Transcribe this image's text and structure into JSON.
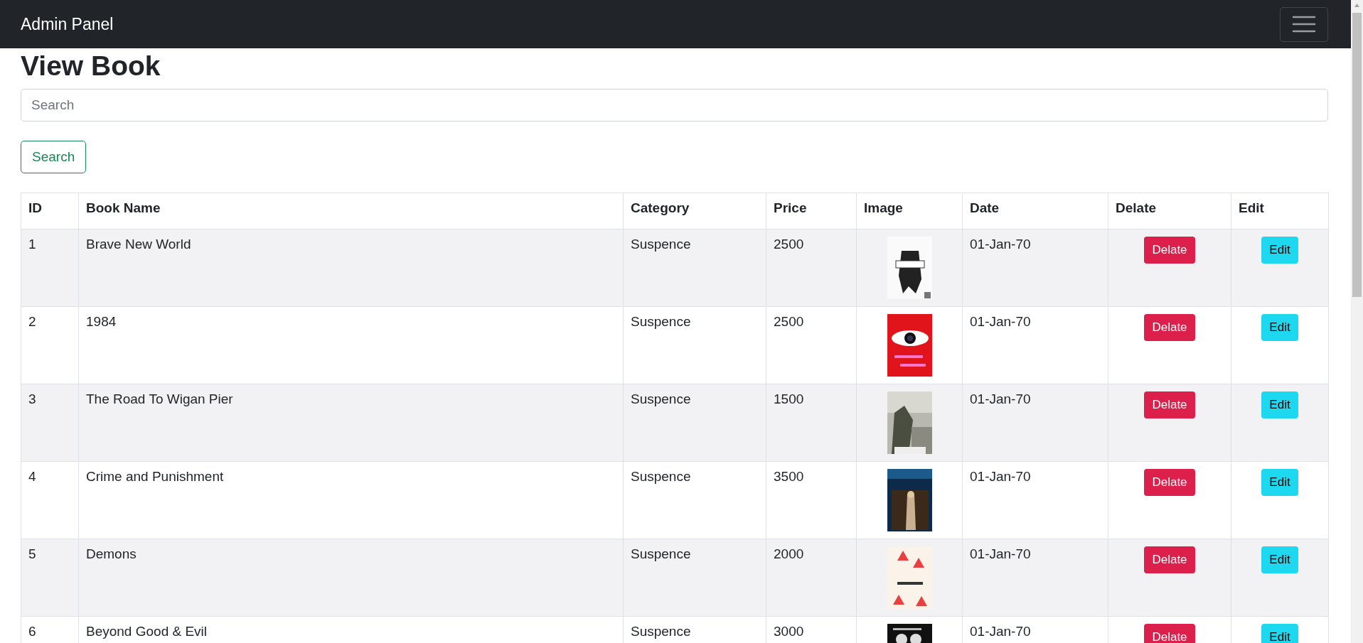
{
  "navbar": {
    "brand": "Admin Panel"
  },
  "page_title": "View Book",
  "search": {
    "placeholder": "Search",
    "button": "Search"
  },
  "table": {
    "columns": [
      "ID",
      "Book Name",
      "Category",
      "Price",
      "Image",
      "Date",
      "Delate",
      "Edit"
    ],
    "rows": [
      {
        "id": "1",
        "name": "Brave New World",
        "category": "Suspence",
        "price": "2500",
        "date": "01-Jan-70",
        "delete": "Delate",
        "edit": "Edit"
      },
      {
        "id": "2",
        "name": "1984",
        "category": "Suspence",
        "price": "2500",
        "date": "01-Jan-70",
        "delete": "Delate",
        "edit": "Edit"
      },
      {
        "id": "3",
        "name": "The Road To Wigan Pier",
        "category": "Suspence",
        "price": "1500",
        "date": "01-Jan-70",
        "delete": "Delate",
        "edit": "Edit"
      },
      {
        "id": "4",
        "name": "Crime and Punishment",
        "category": "Suspence",
        "price": "3500",
        "date": "01-Jan-70",
        "delete": "Delate",
        "edit": "Edit"
      },
      {
        "id": "5",
        "name": "Demons",
        "category": "Suspence",
        "price": "2000",
        "date": "01-Jan-70",
        "delete": "Delate",
        "edit": "Edit"
      },
      {
        "id": "6",
        "name": "Beyond Good & Evil",
        "category": "Suspence",
        "price": "3000",
        "date": "01-Jan-70",
        "delete": "Delate",
        "edit": "Edit"
      }
    ]
  }
}
